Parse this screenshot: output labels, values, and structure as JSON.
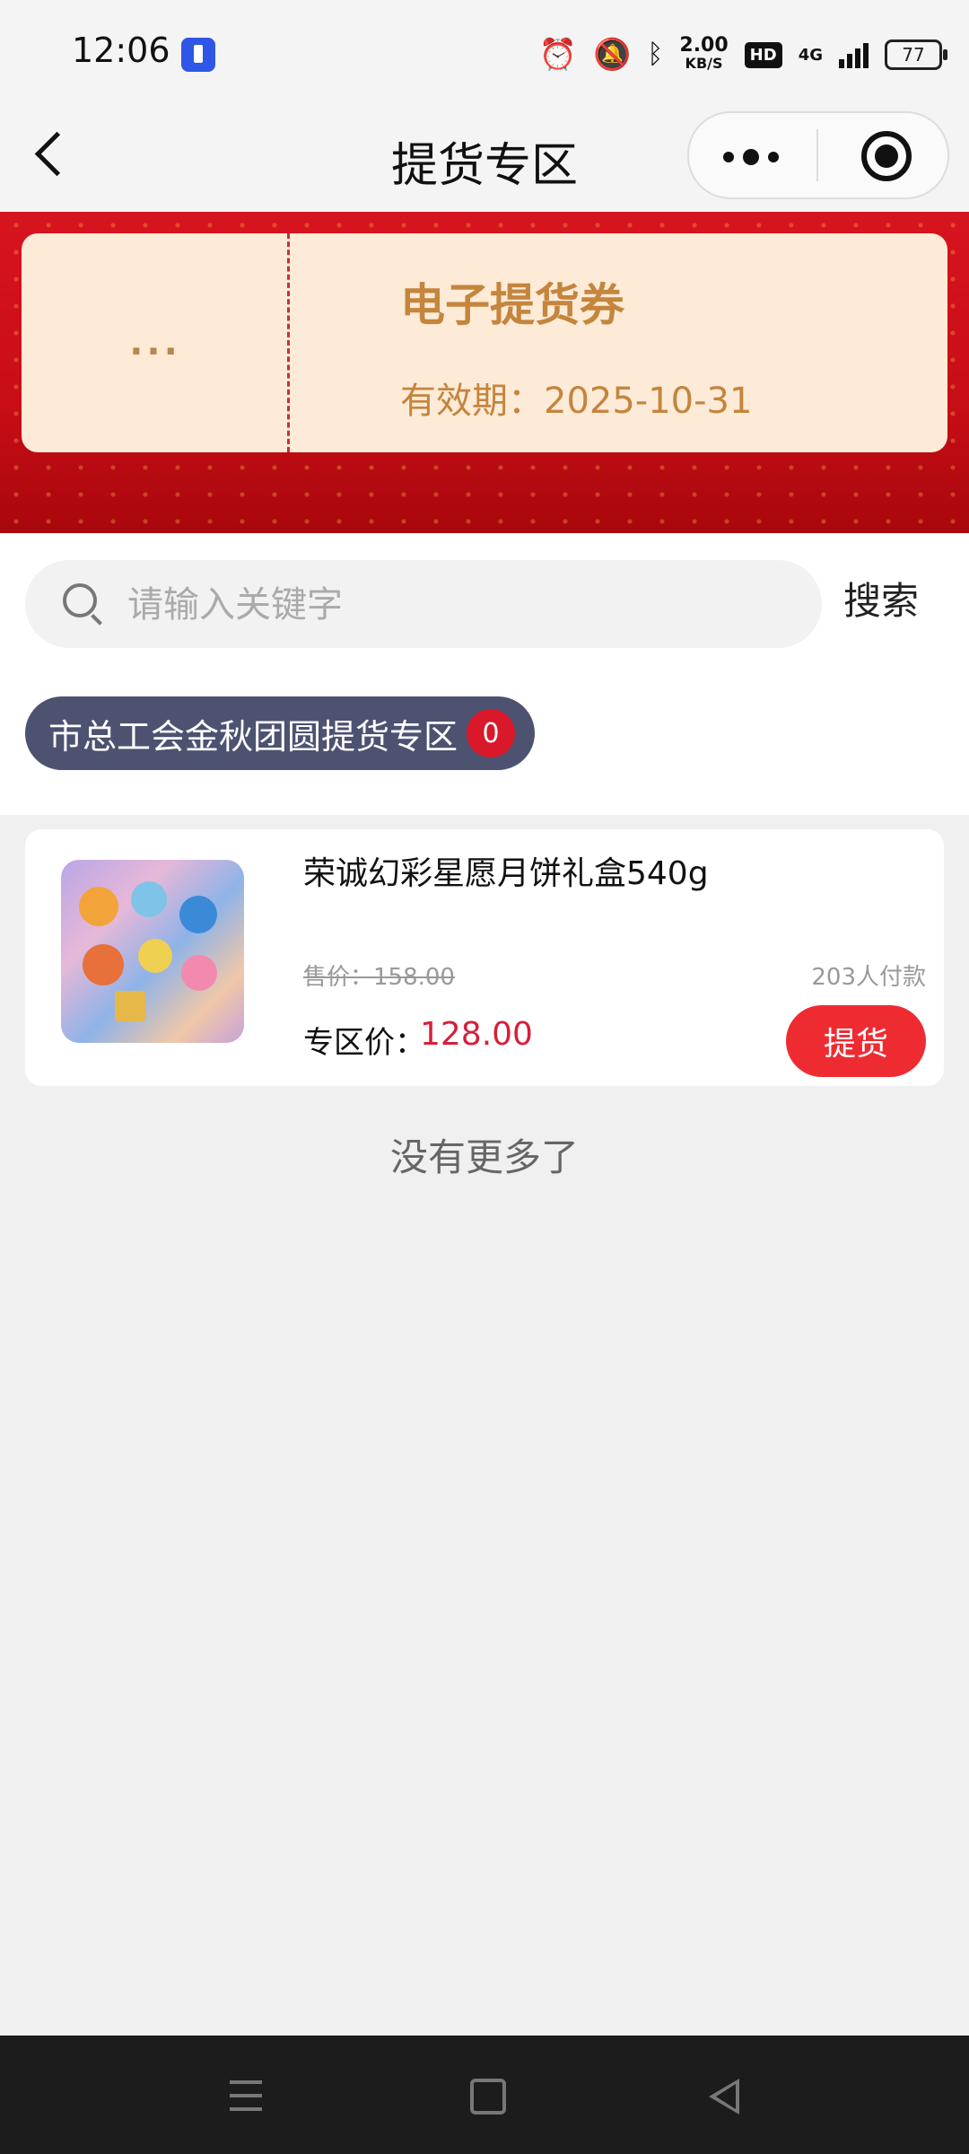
{
  "status_bar": {
    "time": "12:06",
    "network_speed_value": "2.00",
    "network_speed_unit": "KB/S",
    "hd_label": "HD",
    "network_type": "4G",
    "battery": "77"
  },
  "nav": {
    "title": "提货专区"
  },
  "coupon": {
    "left_text": "...",
    "title": "电子提货券",
    "validity": "有效期：2025-10-31"
  },
  "search": {
    "placeholder": "请输入关键字",
    "button_label": "搜索"
  },
  "category": {
    "label": "市总工会金秋团圆提货专区",
    "count": "0"
  },
  "product": {
    "name": "荣诚幻彩星愿月饼礼盒540g",
    "original_price": "售价：158.00",
    "buyers": "203人付款",
    "zone_price_label": "专区价：",
    "zone_price": "128.00",
    "action_label": "提货"
  },
  "footer": {
    "no_more": "没有更多了"
  },
  "colors": {
    "banner_red": "#d7141f",
    "coupon_bg": "#fdebd8",
    "coupon_text": "#c4853d",
    "category_bg": "#4c5270",
    "price_red": "#d61f3a",
    "button_red": "#ef2b32"
  }
}
